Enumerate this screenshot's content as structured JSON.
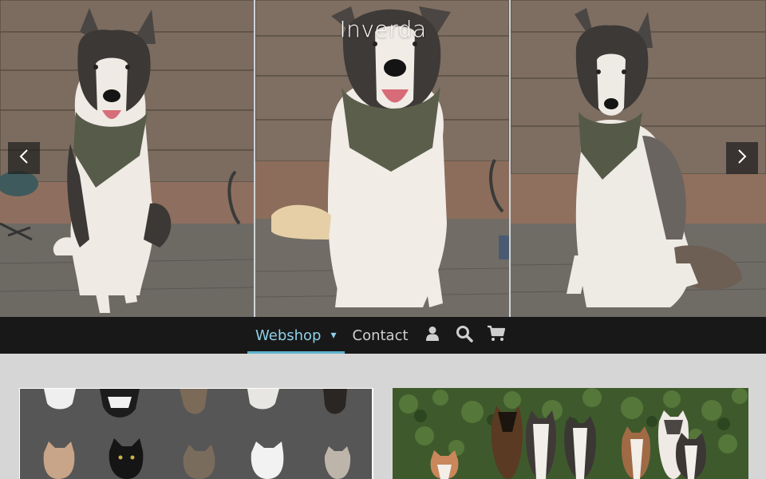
{
  "site": {
    "title": "Inverda"
  },
  "hero": {
    "slides": [
      "husky-photo-1",
      "husky-photo-2",
      "husky-photo-3"
    ],
    "prev_icon": "chevron-left-icon",
    "next_icon": "chevron-right-icon"
  },
  "nav": {
    "items": [
      {
        "label": "Webshop",
        "active": true,
        "has_dropdown": true
      },
      {
        "label": "Contact",
        "active": false
      }
    ],
    "caret": "▾",
    "icons": [
      "user-icon",
      "search-icon",
      "cart-icon"
    ],
    "accent": "#5fb3cf",
    "background": "#181818"
  },
  "cards": [
    {
      "image": "cats-grid-photo"
    },
    {
      "image": "dogs-group-photo"
    }
  ]
}
